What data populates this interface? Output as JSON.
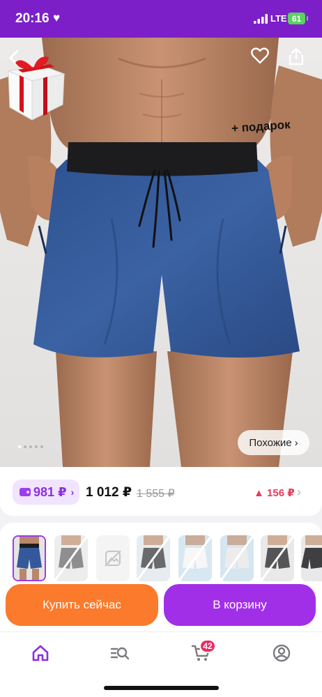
{
  "status_bar": {
    "time": "20:16",
    "network": "LTE",
    "battery": "61",
    "background_color": "#7c1fc9"
  },
  "hero": {
    "promo_label": "+ подарок",
    "similar_label": "Похожие",
    "similar_chevron": "›",
    "gallery_total": 5,
    "gallery_current": 1,
    "icons": [
      "back-arrow-icon",
      "heart-icon",
      "share-icon",
      "gift-box-icon"
    ]
  },
  "pricing": {
    "wallet_price": "981 ₽",
    "wallet_chevron": "›",
    "price": "1 012 ₽",
    "old_price": "1 555 ₽",
    "price_change": "▲ 156 ₽",
    "change_chevron": "›",
    "accent_color": "#8c2ee0",
    "change_color": "#e83a5c"
  },
  "variants": {
    "count": 8,
    "selected_index": 0
  },
  "actions": {
    "buy_now_label": "Купить сейчас",
    "add_to_cart_label": "В корзину",
    "buy_color": "#fb7a2b",
    "cart_color": "#a12fe8"
  },
  "bottom_nav": {
    "items": [
      "home-icon",
      "catalog-search-icon",
      "cart-icon",
      "profile-icon"
    ],
    "active_color": "#8c2ee0",
    "cart_badge": "42"
  }
}
